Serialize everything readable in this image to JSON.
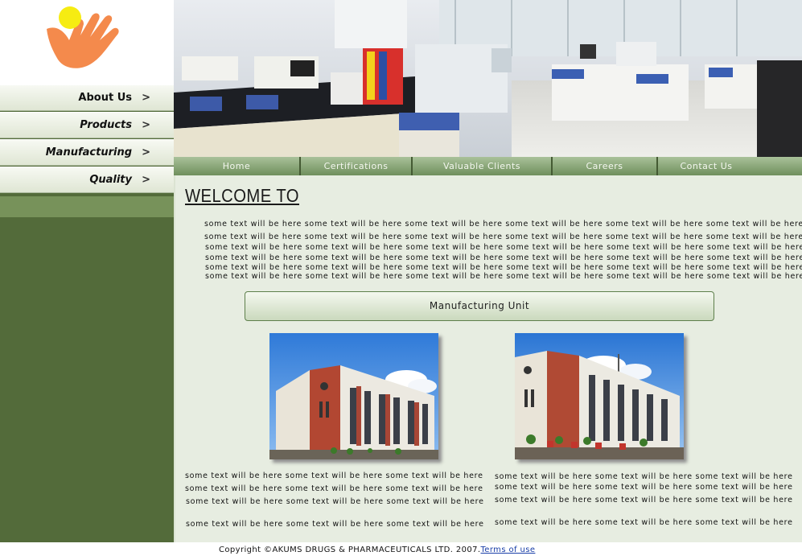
{
  "sidebar": {
    "items": [
      {
        "label": "About Us",
        "arrow": ">"
      },
      {
        "label": "Products",
        "arrow": ">"
      },
      {
        "label": "Manufacturing",
        "arrow": ">"
      },
      {
        "label": "Quality",
        "arrow": ">"
      }
    ]
  },
  "topnav": {
    "items": [
      {
        "label": "Home"
      },
      {
        "label": "Certifications"
      },
      {
        "label": "Valuable Clients"
      },
      {
        "label": "Careers"
      },
      {
        "label": "Contact Us"
      }
    ]
  },
  "main": {
    "welcome": "WELCOME TO",
    "intro_lines": [
      "some text will be here some text will be here some text will be here some text will be here some text will be here some text will be here",
      "some text will be here some text will be here some text will be here some text will be here some text will be here some text will be here",
      "some text will be here some text will be here some text will be here some text will be here some text will be here some text will be here",
      "some text will be here some text will be here some text will be here some text will be here some text will be here some text will be here",
      "some text will be here some text will be here some text will be here some text will be here some text will be here some text will be here",
      "some text will be here some text will be here some text will be here some text will be here some text will be here some text will be here"
    ],
    "section_title": "Manufacturing Unit",
    "left_lines": [
      "some text will be here some text will be here some text will be here",
      "some text will be here some text will be here some text will be here",
      "some text will be here some text will be here some text will be here",
      "some text will be here some text will be here some text will be here"
    ],
    "right_lines": [
      "some text will be here some text will be here some text will be here",
      "some text will be here some text will be here some text will be here",
      "some text will be here some text will be here some text will be here",
      "some text will be here some text will be here some text will be here"
    ]
  },
  "footer": {
    "copyright": "Copyright ©AKUMS DRUGS & PHARMACEUTICALS LTD. 2007.",
    "terms_label": "Terms of use"
  },
  "colors": {
    "sidebar_green": "#536b3a",
    "nav_green": "#6f8f5c",
    "main_bg": "#e7ede1",
    "logo_orange": "#f48a4c",
    "logo_yellow": "#f6ec12",
    "link_blue": "#1a3fa8"
  }
}
